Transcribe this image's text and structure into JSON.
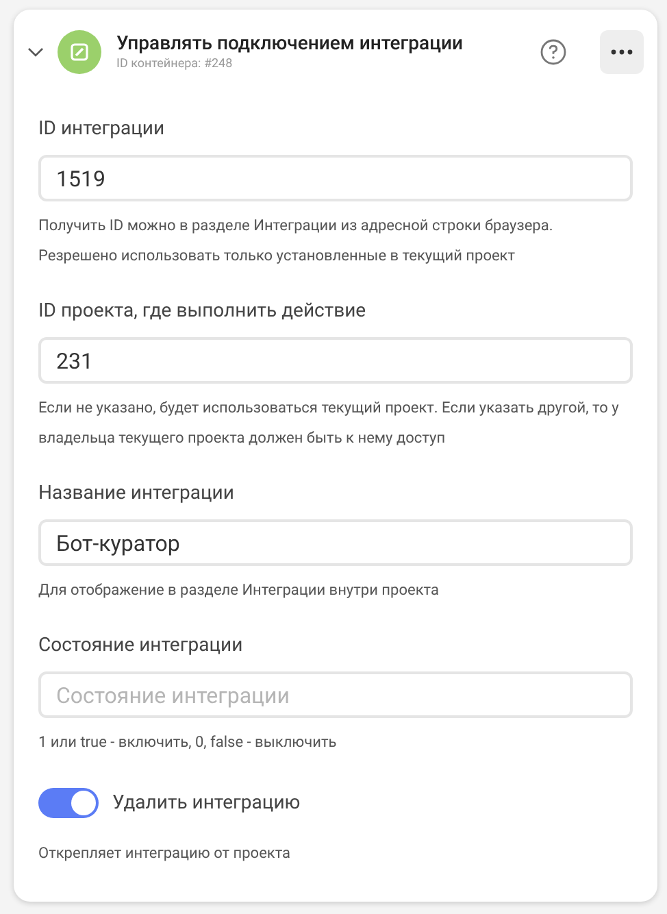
{
  "header": {
    "expanded": true,
    "title": "Управлять подключением интеграции",
    "subtitle": "ID контейнера: #248"
  },
  "fields": [
    {
      "label": "ID интеграции",
      "value": "1519",
      "hint": "Получить ID можно в разделе Интеграции из адресной строки браузера. Резрешено использовать только установленные в текущий проект"
    },
    {
      "label": "ID проекта, где выполнить действие",
      "value": "231",
      "hint": "Если не указано, будет использоваться текущий проект. Если указать другой, то у владельца текущего проекта должен быть к нему доступ"
    },
    {
      "label": "Название интеграции",
      "value": "Бот-куратор",
      "hint": "Для отображение в разделе Интеграции внутри проекта"
    },
    {
      "label": "Состояние интеграции",
      "placeholder": "Состояние интеграции",
      "hint": "1 или true - включить, 0, false - выключить"
    }
  ],
  "toggle": {
    "label": "Удалить интеграцию",
    "on": true,
    "hint": "Открепляет интеграцию от проекта"
  }
}
